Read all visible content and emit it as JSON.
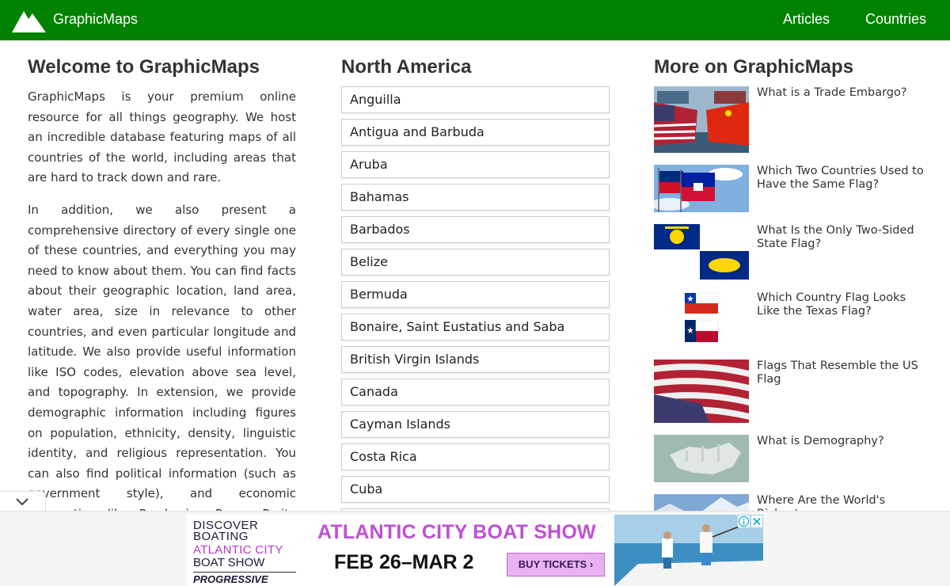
{
  "header": {
    "brand": "GraphicMaps",
    "nav": [
      {
        "label": "Articles"
      },
      {
        "label": "Countries"
      }
    ],
    "color": "#018201"
  },
  "welcome": {
    "title": "Welcome to GraphicMaps",
    "paragraph1": "GraphicMaps is your premium online resource for all things geography. We host an incredible database featuring maps of all countries of the world, including areas that are hard to track down and rare.",
    "paragraph2": "In addition, we also present a comprehensive directory of every single one of these countries, and everything you may need to know about them. You can find facts about their geographic location, land area, water area, size in relevance to other countries, and even particular longitude and latitude. We also provide useful information like ISO codes, elevation above sea level, and topography. In extension, we provide demographic information including figures on population, ethnicity, density, linguistic identity, and religious representation. You can also find political information (such as government style), and economic information like Purchasing Power Parity (PPP) GDP, per capita GDP, wealth and economic sectors. The visual information"
  },
  "north_america": {
    "title": "North America",
    "countries": [
      "Anguilla",
      "Antigua and Barbuda",
      "Aruba",
      "Bahamas",
      "Barbados",
      "Belize",
      "Bermuda",
      "Bonaire, Saint Eustatius and Saba",
      "British Virgin Islands",
      "Canada",
      "Cayman Islands",
      "Costa Rica",
      "Cuba"
    ]
  },
  "more": {
    "title": "More on GraphicMaps",
    "articles": [
      {
        "title": "What is a Trade Embargo?"
      },
      {
        "title": "Which Two Countries Used to Have the Same Flag?"
      },
      {
        "title": "What Is the Only Two-Sided State Flag?"
      },
      {
        "title": "Which Country Flag Looks Like the Texas Flag?"
      },
      {
        "title": "Flags That Resemble the US Flag"
      },
      {
        "title": "What is Demography?"
      },
      {
        "title": "Where Are the World's Richest"
      }
    ]
  },
  "ad": {
    "brand_line1": "DISCOVER",
    "brand_line2": "BOATING",
    "brand_line3": "ATLANTIC CITY",
    "brand_line4": "BOAT SHOW",
    "sponsor": "PROGRESSIVE",
    "headline": "ATLANTIC CITY BOAT SHOW",
    "dates": "FEB 26–MAR 2",
    "cta": "BUY TICKETS ›"
  }
}
